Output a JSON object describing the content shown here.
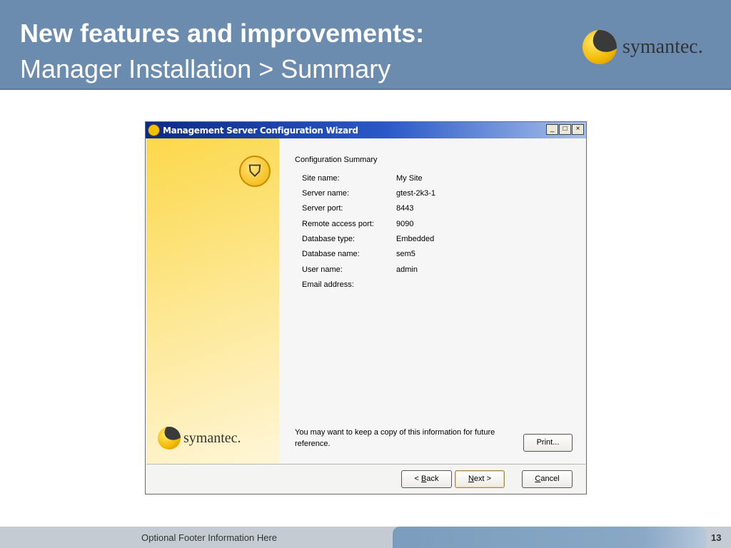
{
  "slide": {
    "title": "New features and improvements:",
    "subtitle": "Manager Installation > Summary",
    "logo": "symantec.",
    "footer": "Optional Footer Information Here",
    "page_number": "13"
  },
  "dialog": {
    "title": "Management Server Configuration Wizard",
    "window_buttons": {
      "minimize": "_",
      "maximize": "□",
      "close": "×"
    },
    "heading": "Configuration Summary",
    "rows": [
      {
        "label": "Site name:",
        "value": "My Site"
      },
      {
        "label": "Server name:",
        "value": "gtest-2k3-1"
      },
      {
        "label": "Server port:",
        "value": "8443"
      },
      {
        "label": "Remote access port:",
        "value": "9090"
      },
      {
        "label": "Database type:",
        "value": "Embedded"
      },
      {
        "label": "Database name:",
        "value": "sem5"
      },
      {
        "label": "User name:",
        "value": "admin"
      },
      {
        "label": "Email address:",
        "value": ""
      }
    ],
    "note": "You may want to keep a copy of this information for future reference.",
    "logo": "symantec.",
    "buttons": {
      "print": "Print...",
      "back_pre": "< ",
      "back_u": "B",
      "back_post": "ack",
      "next_u": "N",
      "next_post": "ext >",
      "cancel_u": "C",
      "cancel_post": "ancel"
    }
  }
}
